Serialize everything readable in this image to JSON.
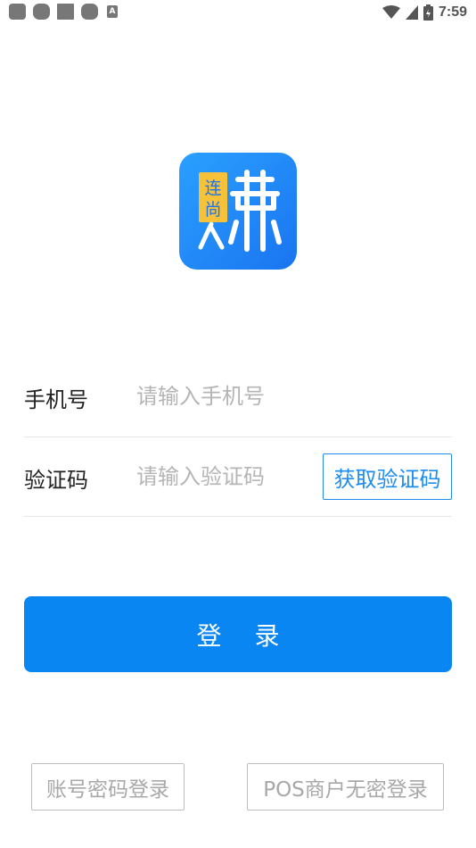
{
  "status_bar": {
    "time": "7:59",
    "left_icons": [
      "notification-icon",
      "notification-icon",
      "notification-icon",
      "notification-icon",
      "a-icon"
    ],
    "right_icons": [
      "wifi-icon",
      "signal-icon",
      "battery-icon"
    ]
  },
  "logo": {
    "badge_text": "连尚",
    "main_glyph": "赚",
    "accent_color": "#1a74f0",
    "badge_color": "#f7c23a"
  },
  "form": {
    "phone": {
      "label": "手机号",
      "placeholder": "请输入手机号",
      "value": ""
    },
    "code": {
      "label": "验证码",
      "placeholder": "请输入验证码",
      "value": "",
      "get_code_label": "获取验证码"
    }
  },
  "login_button": {
    "label": "登 录",
    "color": "#0a86f2"
  },
  "alt_logins": {
    "account_password": "账号密码登录",
    "pos_merchant": "POS商户无密登录"
  }
}
